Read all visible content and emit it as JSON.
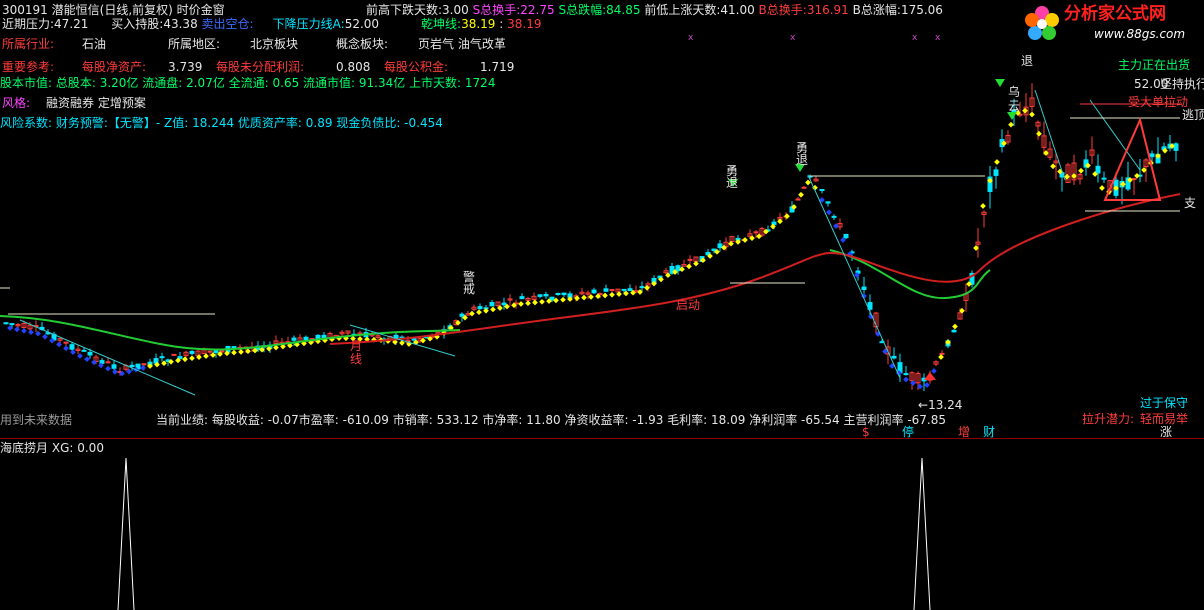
{
  "title_line": {
    "code": "300191",
    "name": "潜能恒信(日线,前复权)",
    "window": "时价金窗",
    "days_down_label": "前高下跌天数:",
    "days_down": "3.00",
    "s_turnover_label": "S总换手:",
    "s_turnover": "22.75",
    "s_drop_label": "S总跌幅:",
    "s_drop": "84.85",
    "days_up_label": "前低上涨天数:",
    "days_up": "41.00",
    "b_turnover_label": "B总换手:",
    "b_turnover": "316.91",
    "b_rise_label": "B总涨幅:",
    "b_rise": "175.06"
  },
  "line2": {
    "pressure_label": "近期压力:",
    "pressure": "47.21",
    "support_label": "买入持股:",
    "support": "43.38",
    "empty_label": "卖出空仓:",
    "down_line_label": "下降压力线A:",
    "down_line": "52.00",
    "qiankun_label": "乾坤线:",
    "qiankun_a": "38.19",
    "qiankun_b": "38.19"
  },
  "line3": {
    "industry_label": "所属行业:",
    "industry": "石油",
    "region_label": "所属地区:",
    "region": "北京板块",
    "concept_label": "概念板块:",
    "concept": "页岩气 油气改革"
  },
  "line4": {
    "ref_label": "重要参考:",
    "net_asset_label": "每股净资产:",
    "net_asset": "3.739",
    "undistributed_label": "每股未分配利润:",
    "undistributed": "0.808",
    "reserve_label": "每股公积金:",
    "reserve": "1.719"
  },
  "line5": "股本市值: 总股本: 3.20亿 流通盘: 2.07亿 全流通: 0.65 流通市值: 91.34亿 上市天数: 1724",
  "line6": {
    "style_label": "风格:",
    "style": "融资融券 定增预案"
  },
  "line7": "风险系数: 财务预警:【无警】- Z值: 18.244 优质资产率: 0.89 现金负债比: -0.454",
  "performance": "当前业绩: 每股收益: -0.07市盈率: -610.09 市销率: 533.12 市净率: 11.80 净资收益率: -1.93 毛利率: 18.09 净利润率 -65.54 主营利润率 -67.85",
  "future_note": "用到未来数据",
  "right_labels": {
    "main_force": "主力正在出货",
    "price_52": "52.00",
    "break_trade": "坚持执行",
    "fake_pull": "受大单拉动",
    "escape": "逃顶",
    "support": "支",
    "over_guard": "过于保守",
    "potential_label": "拉升潜力:",
    "potential": "轻而易举"
  },
  "chart_labels": {
    "low_price": "13.24",
    "launch": "启动",
    "month_line": "月线",
    "warn": "警戒",
    "brave_retreat_1": "勇退",
    "brave_retreat_2": "勇退",
    "retreat": "退",
    "wuyun": "乌云",
    "bottom_tags": [
      "$",
      "停",
      "增",
      "财"
    ],
    "right_tag": "涨"
  },
  "lower_panel": {
    "indicator_label": "海底捞月",
    "xg_label": "XG:",
    "xg_value": "0.00"
  },
  "logo": {
    "text": "分析家公式网",
    "url": "www.88gs.com"
  },
  "colors": {
    "up": "#ff3c3c",
    "down": "#00e5ff",
    "ma_red": "#d01f1f",
    "ma_green": "#22cc33",
    "dots": "#ffff00",
    "separator": "#8c0000"
  }
}
